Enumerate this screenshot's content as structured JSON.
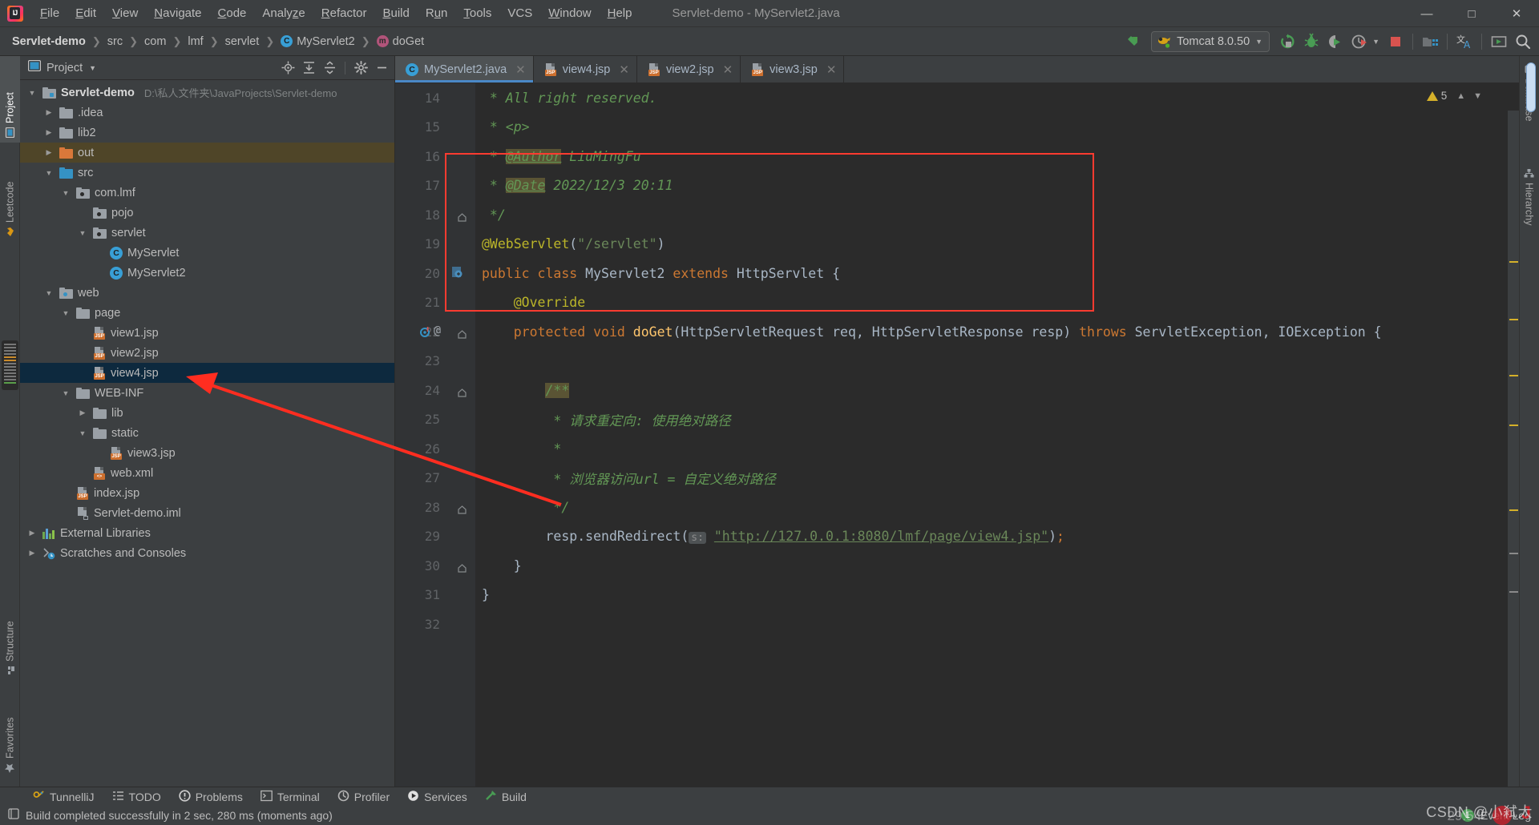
{
  "window": {
    "title": "Servlet-demo - MyServlet2.java",
    "controls": [
      "minimize",
      "maximize",
      "close"
    ]
  },
  "menubar": {
    "items": [
      {
        "label": "File",
        "mnemonic": "F"
      },
      {
        "label": "Edit",
        "mnemonic": "E"
      },
      {
        "label": "View",
        "mnemonic": "V"
      },
      {
        "label": "Navigate",
        "mnemonic": "N"
      },
      {
        "label": "Code",
        "mnemonic": "C"
      },
      {
        "label": "Analyze",
        "mnemonic": "z"
      },
      {
        "label": "Refactor",
        "mnemonic": "R"
      },
      {
        "label": "Build",
        "mnemonic": "B"
      },
      {
        "label": "Run",
        "mnemonic": "u"
      },
      {
        "label": "Tools",
        "mnemonic": "T"
      },
      {
        "label": "VCS",
        "mnemonic": ""
      },
      {
        "label": "Window",
        "mnemonic": "W"
      },
      {
        "label": "Help",
        "mnemonic": "H"
      }
    ]
  },
  "breadcrumb": {
    "items": [
      {
        "label": "Servlet-demo",
        "kind": "project"
      },
      {
        "label": "src",
        "kind": "dir"
      },
      {
        "label": "com",
        "kind": "dir"
      },
      {
        "label": "lmf",
        "kind": "dir"
      },
      {
        "label": "servlet",
        "kind": "dir"
      },
      {
        "label": "MyServlet2",
        "kind": "class",
        "badge": "C"
      },
      {
        "label": "doGet",
        "kind": "method",
        "badge": "m"
      }
    ]
  },
  "toolbar": {
    "run_config": "Tomcat 8.0.50",
    "icons": [
      {
        "name": "back-arrow-icon"
      },
      {
        "name": "rerun-icon"
      },
      {
        "name": "debug-icon"
      },
      {
        "name": "run-with-coverage-icon"
      },
      {
        "name": "profiler-icon"
      },
      {
        "name": "stop-icon"
      },
      {
        "name": "project-structure-icon"
      },
      {
        "name": "translate-icon"
      },
      {
        "name": "presentation-icon"
      },
      {
        "name": "search-icon"
      }
    ]
  },
  "left_strip": {
    "tabs": [
      {
        "label": "Project",
        "icon": "project-icon",
        "selected": true
      },
      {
        "label": "Leetcode",
        "icon": "leetcode-icon",
        "selected": false
      }
    ],
    "bottom_tabs": [
      {
        "label": "Structure",
        "icon": "structure-icon"
      },
      {
        "label": "Favorites",
        "icon": "star-icon"
      }
    ]
  },
  "right_strip": {
    "tabs": [
      {
        "label": "Database",
        "icon": "database-icon"
      },
      {
        "label": "Hierarchy",
        "icon": "hierarchy-icon"
      }
    ]
  },
  "project_panel": {
    "title": "Project",
    "header_icons": [
      {
        "name": "locate-icon"
      },
      {
        "name": "expand-all-icon"
      },
      {
        "name": "collapse-all-icon"
      },
      {
        "name": "gear-icon"
      },
      {
        "name": "hide-icon"
      }
    ],
    "tree": [
      {
        "label": "Servlet-demo",
        "path": "D:\\私人文件夹\\JavaProjects\\Servlet-demo",
        "indent": 0,
        "twist": "down",
        "icon": "project-folder",
        "bold": true,
        "state": "normal"
      },
      {
        "label": ".idea",
        "indent": 1,
        "twist": "right",
        "icon": "folder-grey",
        "state": "normal"
      },
      {
        "label": "lib2",
        "indent": 1,
        "twist": "right",
        "icon": "folder-grey",
        "state": "normal"
      },
      {
        "label": "out",
        "indent": 1,
        "twist": "right",
        "icon": "folder-orange",
        "state": "highlight"
      },
      {
        "label": "src",
        "indent": 1,
        "twist": "down",
        "icon": "folder-blue",
        "state": "normal"
      },
      {
        "label": "com.lmf",
        "indent": 2,
        "twist": "down",
        "icon": "package",
        "state": "normal"
      },
      {
        "label": "pojo",
        "indent": 3,
        "twist": "none",
        "icon": "package",
        "state": "normal"
      },
      {
        "label": "servlet",
        "indent": 3,
        "twist": "down",
        "icon": "package",
        "state": "normal"
      },
      {
        "label": "MyServlet",
        "indent": 4,
        "twist": "none",
        "icon": "java-class",
        "state": "normal"
      },
      {
        "label": "MyServlet2",
        "indent": 4,
        "twist": "none",
        "icon": "java-class",
        "state": "normal"
      },
      {
        "label": "web",
        "indent": 1,
        "twist": "down",
        "icon": "web-folder",
        "state": "normal"
      },
      {
        "label": "page",
        "indent": 2,
        "twist": "down",
        "icon": "folder-grey",
        "state": "normal"
      },
      {
        "label": "view1.jsp",
        "indent": 3,
        "twist": "none",
        "icon": "jsp-file",
        "state": "normal"
      },
      {
        "label": "view2.jsp",
        "indent": 3,
        "twist": "none",
        "icon": "jsp-file",
        "state": "normal"
      },
      {
        "label": "view4.jsp",
        "indent": 3,
        "twist": "none",
        "icon": "jsp-file",
        "state": "selected"
      },
      {
        "label": "WEB-INF",
        "indent": 2,
        "twist": "down",
        "icon": "folder-grey",
        "state": "normal"
      },
      {
        "label": "lib",
        "indent": 3,
        "twist": "right",
        "icon": "folder-grey",
        "state": "normal"
      },
      {
        "label": "static",
        "indent": 3,
        "twist": "down",
        "icon": "folder-grey",
        "state": "normal"
      },
      {
        "label": "view3.jsp",
        "indent": 4,
        "twist": "none",
        "icon": "jsp-file",
        "state": "normal"
      },
      {
        "label": "web.xml",
        "indent": 3,
        "twist": "none",
        "icon": "xml-file",
        "state": "normal"
      },
      {
        "label": "index.jsp",
        "indent": 2,
        "twist": "none",
        "icon": "jsp-file",
        "state": "normal"
      },
      {
        "label": "Servlet-demo.iml",
        "indent": 2,
        "twist": "none",
        "icon": "iml-file",
        "state": "normal"
      },
      {
        "label": "External Libraries",
        "indent": 0,
        "twist": "right",
        "icon": "libraries",
        "state": "normal"
      },
      {
        "label": "Scratches and Consoles",
        "indent": 0,
        "twist": "right",
        "icon": "scratches",
        "state": "normal"
      }
    ]
  },
  "editor": {
    "tabs": [
      {
        "label": "MyServlet2.java",
        "icon": "java-class",
        "active": true
      },
      {
        "label": "view4.jsp",
        "icon": "jsp-file",
        "active": false
      },
      {
        "label": "view2.jsp",
        "icon": "jsp-file",
        "active": false
      },
      {
        "label": "view3.jsp",
        "icon": "jsp-file",
        "active": false
      }
    ],
    "inspection_count": "5",
    "lines": [
      {
        "num": "14",
        "type": "comment",
        "text": " * All right reserved."
      },
      {
        "num": "15",
        "type": "comment",
        "text": " * <p>"
      },
      {
        "num": "16",
        "type": "javadoc_tag",
        "prefix": " * ",
        "tag": "@Author",
        "rest": " LiuMingFu"
      },
      {
        "num": "17",
        "type": "javadoc_tag",
        "prefix": " * ",
        "tag": "@Date",
        "rest": " 2022/12/3 20:11"
      },
      {
        "num": "18",
        "type": "comment",
        "text": " */",
        "fold": true
      },
      {
        "num": "19",
        "type": "annotation",
        "ann": "@WebServlet",
        "paren_open": "(",
        "str": "\"/servlet\"",
        "paren_close": ")"
      },
      {
        "num": "20",
        "type": "class_decl",
        "text": "public class MyServlet2 extends HttpServlet {",
        "gutter_icon": "override-marker"
      },
      {
        "num": "21",
        "type": "annotation_plain",
        "text": "    @Override"
      },
      {
        "num": "22",
        "type": "method_decl",
        "text": "    protected void doGet(HttpServletRequest req, HttpServletResponse resp) throws ServletException, IOException {",
        "gutter_icon": "breakpoint-implements",
        "fold": true
      },
      {
        "num": "23",
        "type": "blank",
        "text": ""
      },
      {
        "num": "24",
        "type": "comment_start",
        "text": "        /**",
        "fold": true
      },
      {
        "num": "25",
        "type": "comment",
        "text": "         * 请求重定向: 使用绝对路径"
      },
      {
        "num": "26",
        "type": "comment",
        "text": "         *"
      },
      {
        "num": "27",
        "type": "comment",
        "text": "         * 浏览器访问url = 自定义绝对路径"
      },
      {
        "num": "28",
        "type": "comment",
        "text": "         */",
        "fold": true
      },
      {
        "num": "29",
        "type": "redirect",
        "text": "        resp.sendRedirect( s: \"http://127.0.0.1:8080/lmf/page/view4.jsp\");",
        "hint": "s:",
        "url": "\"http://127.0.0.1:8080/lmf/page/view4.jsp\""
      },
      {
        "num": "30",
        "type": "plain",
        "text": "    }",
        "fold": true
      },
      {
        "num": "31",
        "type": "plain",
        "text": "}"
      },
      {
        "num": "32",
        "type": "blank",
        "text": ""
      }
    ],
    "annotation_box": {
      "color": "#ff3b30",
      "label": "red-highlight-box"
    },
    "annotation_arrow": {
      "color": "#ff2d20",
      "label": "red-arrow-to-view4"
    }
  },
  "bottom_bar": {
    "items": [
      {
        "label": "TunnelliJ",
        "icon": "tunnel-icon"
      },
      {
        "label": "TODO",
        "icon": "todo-icon"
      },
      {
        "label": "Problems",
        "icon": "problems-icon"
      },
      {
        "label": "Terminal",
        "icon": "terminal-icon"
      },
      {
        "label": "Profiler",
        "icon": "profiler-icon"
      },
      {
        "label": "Services",
        "icon": "services-icon"
      },
      {
        "label": "Build",
        "icon": "build-icon"
      }
    ]
  },
  "statusbar": {
    "message": "Build completed successfully in 2 sec, 280 ms (moments ago)",
    "event_log_label": "Event Log",
    "event_log_count": "1"
  },
  "watermark": {
    "text": "CSDN @小弒大",
    "time": "29:54"
  },
  "colors": {
    "accent": "#4a88c7",
    "highlight_box": "#ff3b30",
    "arrow": "#ff2d20",
    "comment": "#629755",
    "keyword": "#cc7832",
    "string": "#6a8759",
    "annotation": "#bbb529",
    "method": "#ffc66d",
    "selection": "#0d293e"
  }
}
